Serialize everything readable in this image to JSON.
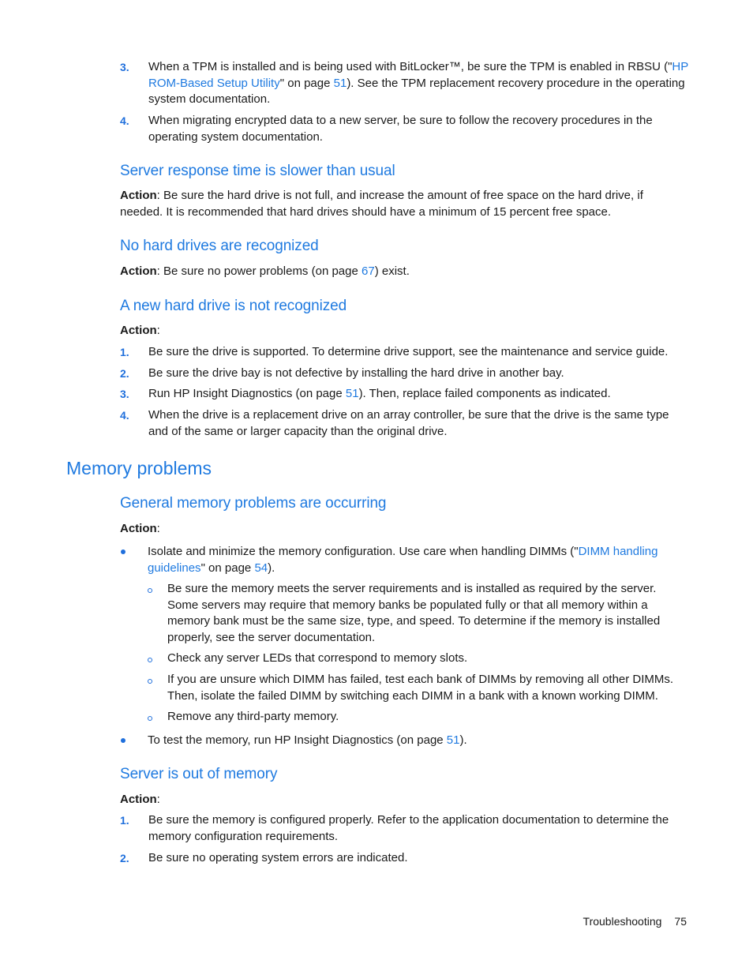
{
  "top_list": [
    {
      "number": "3.",
      "text_before": "When a TPM is installed and is being used with BitLocker™, be sure the TPM is enabled in RBSU (\"",
      "link_text": "HP ROM-Based Setup Utility",
      "text_mid": "\" on page ",
      "page_link": "51",
      "text_after": "). See the TPM replacement recovery procedure in the operating system documentation."
    },
    {
      "number": "4.",
      "text": "When migrating encrypted data to a new server, be sure to follow the recovery procedures in the operating system documentation."
    }
  ],
  "section_slow": {
    "heading": "Server response time is slower than usual",
    "action_label": "Action",
    "action_text": ": Be sure the hard drive is not full, and increase the amount of free space on the hard drive, if needed. It is recommended that hard drives should have a minimum of 15 percent free space."
  },
  "section_no_drives": {
    "heading": "No hard drives are recognized",
    "action_label": "Action",
    "text_before": ": Be sure no power problems (on page ",
    "page_link": "67",
    "text_after": ") exist."
  },
  "section_new_drive": {
    "heading": "A new hard drive is not recognized",
    "action_label": "Action",
    "action_colon": ":",
    "items": [
      {
        "number": "1.",
        "text": "Be sure the drive is supported. To determine drive support, see the maintenance and service guide."
      },
      {
        "number": "2.",
        "text": "Be sure the drive bay is not defective by installing the hard drive in another bay."
      },
      {
        "number": "3.",
        "text_before": "Run HP Insight Diagnostics (on page ",
        "page_link": "51",
        "text_after": "). Then, replace failed components as indicated."
      },
      {
        "number": "4.",
        "text": "When the drive is a replacement drive on an array controller, be sure that the drive is the same type and of the same or larger capacity than the original drive."
      }
    ]
  },
  "memory_problems": {
    "heading": "Memory problems",
    "general": {
      "heading": "General memory problems are occurring",
      "action_label": "Action",
      "action_colon": ":",
      "bullet1": {
        "text_before": "Isolate and minimize the memory configuration. Use care when handling DIMMs (\"",
        "link_text": "DIMM handling guidelines",
        "text_mid": "\" on page ",
        "page_link": "54",
        "text_after": ")."
      },
      "sub_items": [
        "Be sure the memory meets the server requirements and is installed as required by the server. Some servers may require that memory banks be populated fully or that all memory within a memory bank must be the same size, type, and speed. To determine if the memory is installed properly, see the server documentation.",
        "Check any server LEDs that correspond to memory slots.",
        "If you are unsure which DIMM has failed, test each bank of DIMMs by removing all other DIMMs. Then, isolate the failed DIMM by switching each DIMM in a bank with a known working DIMM.",
        "Remove any third-party memory."
      ],
      "bullet2": {
        "text_before": "To test the memory, run HP Insight Diagnostics (on page ",
        "page_link": "51",
        "text_after": ")."
      }
    },
    "out_of_memory": {
      "heading": "Server is out of memory",
      "action_label": "Action",
      "action_colon": ":",
      "items": [
        {
          "number": "1.",
          "text": "Be sure the memory is configured properly. Refer to the application documentation to determine the memory configuration requirements."
        },
        {
          "number": "2.",
          "text": "Be sure no operating system errors are indicated."
        }
      ]
    }
  },
  "footer": {
    "section": "Troubleshooting",
    "page_number": "75"
  }
}
